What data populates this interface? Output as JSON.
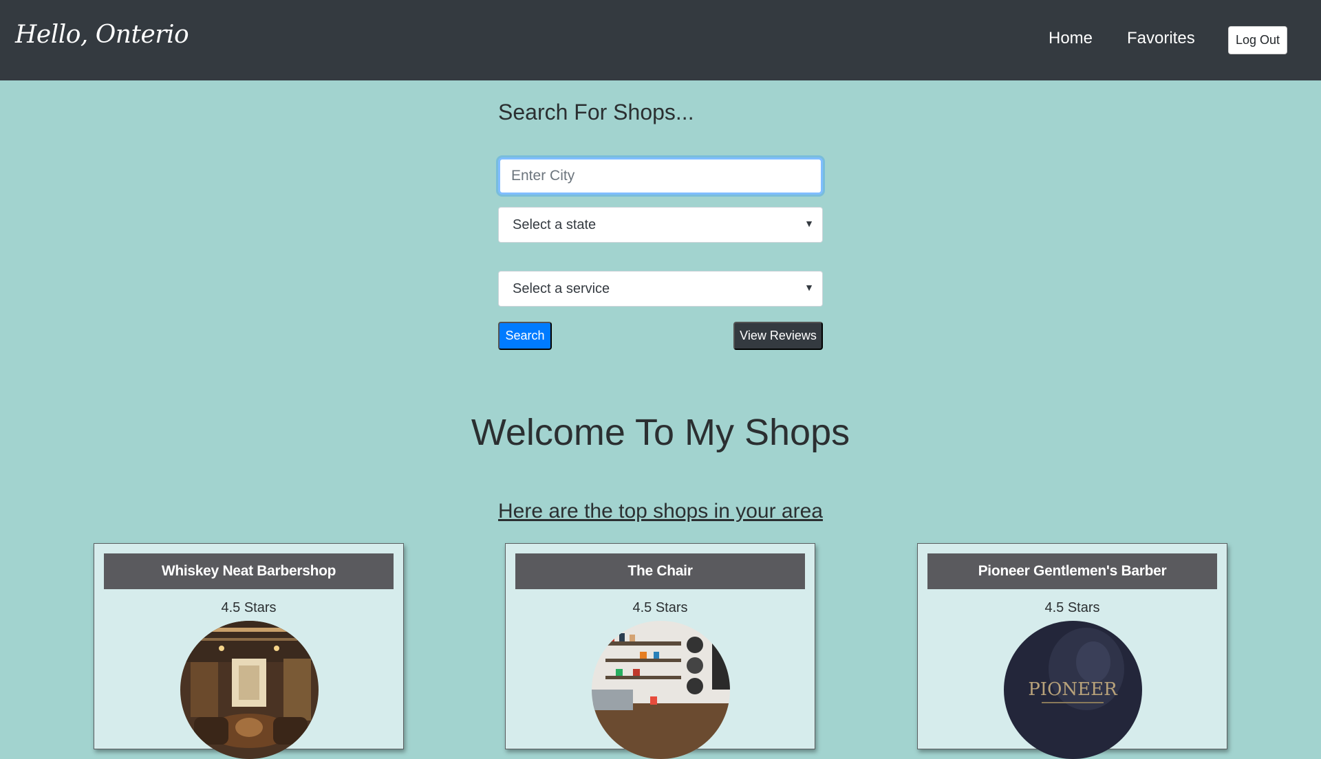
{
  "navbar": {
    "brand": "Hello, Onterio",
    "links": [
      {
        "label": "Home"
      },
      {
        "label": "Favorites"
      }
    ],
    "logout_label": "Log Out"
  },
  "search": {
    "heading": "Search For Shops...",
    "city_placeholder": "Enter City",
    "state_select": "Select a state",
    "service_select": "Select a service",
    "search_button": "Search",
    "reviews_button": "View Reviews"
  },
  "main": {
    "welcome": "Welcome To My Shops",
    "subheading": "Here are the top shops in your area"
  },
  "shops": [
    {
      "name": "Whiskey Neat Barbershop",
      "rating": "4.5 Stars"
    },
    {
      "name": "The Chair",
      "rating": "4.5 Stars"
    },
    {
      "name": "Pioneer Gentlemen's Barber",
      "rating": "4.5 Stars",
      "image_text": "PIONEER"
    }
  ],
  "colors": {
    "navbar": "#343a40",
    "background": "#a2d3cf",
    "primary": "#007bff",
    "card_title": "#5a5a5e",
    "card_bg": "#d6ecec"
  }
}
